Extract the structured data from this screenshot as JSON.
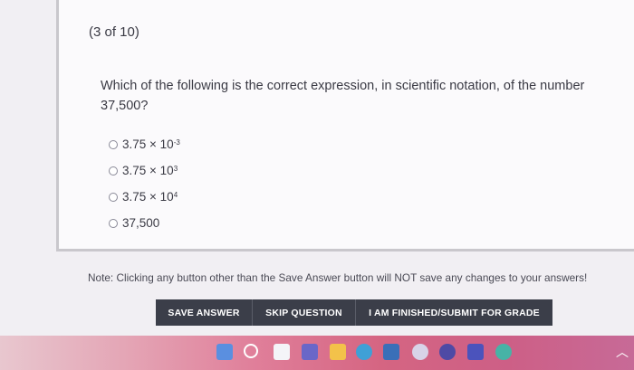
{
  "question": {
    "counter": "(3 of 10)",
    "prompt": "Which of the following is the correct expression, in scientific notation, of the number 37,500?"
  },
  "options": [
    {
      "base": "3.75 × 10",
      "exp": "-3"
    },
    {
      "base": "3.75 × 10",
      "exp": "3"
    },
    {
      "base": "3.75 × 10",
      "exp": "4"
    },
    {
      "base": "37,500",
      "exp": ""
    }
  ],
  "note": "Note: Clicking any button other than the Save Answer button will NOT save any changes to your answers!",
  "buttons": {
    "save": "SAVE ANSWER",
    "skip": "SKIP QUESTION",
    "submit": "I AM FINISHED/SUBMIT FOR GRADE"
  },
  "taskbar": {
    "icons": [
      "start-icon",
      "search-icon",
      "task-view-icon",
      "video-call-icon",
      "file-explorer-icon",
      "edge-icon",
      "store-icon",
      "chrome-icon",
      "app-icon",
      "teams-icon",
      "paint-icon"
    ],
    "accent": "#d56582"
  }
}
